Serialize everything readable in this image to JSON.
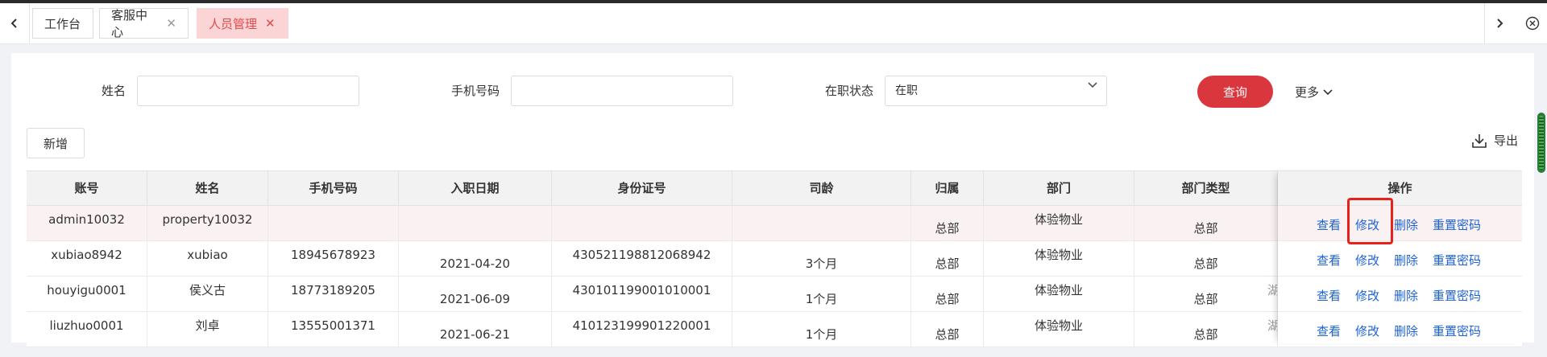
{
  "tabs": [
    {
      "label": "工作台",
      "closable": false,
      "active": false
    },
    {
      "label": "客服中心",
      "closable": true,
      "active": false
    },
    {
      "label": "人员管理",
      "closable": true,
      "active": true
    }
  ],
  "filters": {
    "name_label": "姓名",
    "name_value": "",
    "name_placeholder": "",
    "phone_label": "手机号码",
    "phone_value": "",
    "phone_placeholder": "",
    "status_label": "在职状态",
    "status_value": "在职",
    "query_label": "查询",
    "more_label": "更多"
  },
  "toolbar": {
    "add_label": "新增",
    "export_label": "导出"
  },
  "table": {
    "headers": [
      "账号",
      "姓名",
      "手机号码",
      "入职日期",
      "身份证号",
      "司龄",
      "归属",
      "部门",
      "部门类型",
      "",
      "操作"
    ],
    "rows": [
      {
        "account": "admin10032",
        "name": "property10032",
        "phone": "",
        "hire_date": "",
        "id_number": "",
        "tenure": "",
        "affiliation": "总部",
        "department": "体验物业",
        "dept_type": "总部",
        "clipped": ""
      },
      {
        "account": "xubiao8942",
        "name": "xubiao",
        "phone": "18945678923",
        "hire_date": "2021-04-20",
        "id_number": "430521198812068942",
        "tenure": "3个月",
        "affiliation": "总部",
        "department": "体验物业",
        "dept_type": "总部",
        "clipped": ""
      },
      {
        "account": "houyigu0001",
        "name": "侯义古",
        "phone": "18773189205",
        "hire_date": "2021-06-09",
        "id_number": "430101199001010001",
        "tenure": "1个月",
        "affiliation": "总部",
        "department": "体验物业",
        "dept_type": "总部",
        "clipped": "湖"
      },
      {
        "account": "liuzhuo0001",
        "name": "刘卓",
        "phone": "13555001371",
        "hire_date": "2021-06-21",
        "id_number": "410123199901220001",
        "tenure": "1个月",
        "affiliation": "总部",
        "department": "体验物业",
        "dept_type": "总部",
        "clipped": "湖"
      }
    ],
    "actions": {
      "view": "查看",
      "edit": "修改",
      "delete": "删除",
      "reset_password": "重置密码"
    }
  },
  "colors": {
    "accent": "#d9363e",
    "link": "#1e63d6",
    "active_tab_bg": "#fbd5d6",
    "highlight": "#e8221b"
  }
}
